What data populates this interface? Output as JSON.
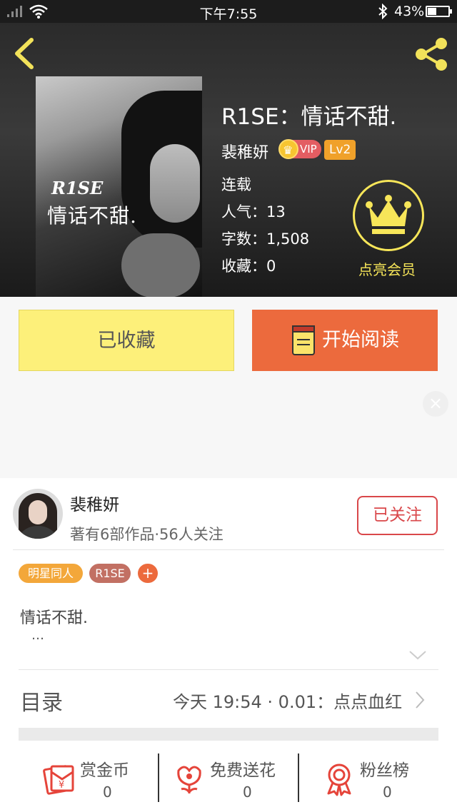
{
  "status_bar": {
    "time": "下午7:55",
    "battery": "43%",
    "battery_level": 0.43
  },
  "book": {
    "cover_title_line1": "R1SE",
    "cover_title_line2": "情话不甜.",
    "title": "R1SE：情话不甜.",
    "author": "裴稚妍",
    "vip_label": "VIP",
    "level": "Lv2",
    "status": "连载",
    "popularity": "人气：13",
    "word_count": "字数：1,508",
    "favorites": "收藏：0"
  },
  "member": {
    "label": "点亮会员"
  },
  "actions": {
    "collected": "已收藏",
    "start_reading": "开始阅读"
  },
  "author_card": {
    "name": "裴稚妍",
    "stats": "著有6部作品·56人关注",
    "follow": "已关注"
  },
  "tags": [
    "明星同人",
    "R1SE",
    "+"
  ],
  "intro": {
    "text": "情话不甜.",
    "more": "…"
  },
  "toc": {
    "label": "目录",
    "latest": "今天 19:54 · 0.01：点点血红"
  },
  "bottom_bar": [
    {
      "label": "赏金币",
      "value": "0",
      "icon": "red-envelope-icon"
    },
    {
      "label": "免费送花",
      "value": "0",
      "icon": "flower-icon"
    },
    {
      "label": "粉丝榜",
      "value": "0",
      "icon": "medal-icon"
    }
  ],
  "colors": {
    "accent_orange": "#ec6a3d",
    "collected_yellow": "#fdf07a",
    "member_yellow": "#f7e659",
    "follow_red": "#d9474a",
    "icon_red": "#e5443a"
  }
}
